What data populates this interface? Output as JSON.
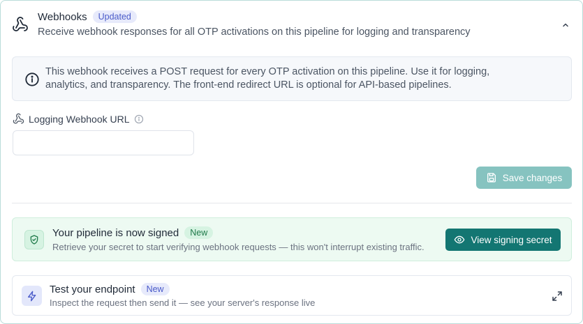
{
  "header": {
    "title": "Webhooks",
    "badge": "Updated",
    "subtitle": "Receive webhook responses for all OTP activations on this pipeline for logging and transparency",
    "icon": "webhook-icon",
    "toggle_icon": "chevron-up-icon"
  },
  "info": {
    "icon": "info-circle-icon",
    "text": "This webhook receives a POST request for every OTP activation on this pipeline. Use it for logging, analytics, and transparency. The front-end redirect URL is optional for API-based pipelines."
  },
  "url_field": {
    "label": "Logging Webhook URL",
    "value": "",
    "placeholder": "",
    "label_icon": "webhook-icon",
    "help_icon": "info-circle-icon"
  },
  "save_button": {
    "label": "Save changes",
    "icon": "save-icon"
  },
  "signed": {
    "title": "Your pipeline is now signed",
    "badge": "New",
    "subtitle": "Retrieve your secret to start verifying webhook requests — this won't interrupt existing traffic.",
    "icon": "shield-check-icon",
    "button_label": "View signing secret",
    "button_icon": "eye-icon"
  },
  "test": {
    "title": "Test your endpoint",
    "badge": "New",
    "subtitle": "Inspect the request then send it — see your server's response live",
    "icon": "bolt-icon",
    "expand_icon": "expand-icon"
  },
  "colors": {
    "accent": "#137672",
    "accent_disabled": "#86c3c0",
    "success_bg": "#edfaf2",
    "badge_blue": "#4a5bc9"
  }
}
